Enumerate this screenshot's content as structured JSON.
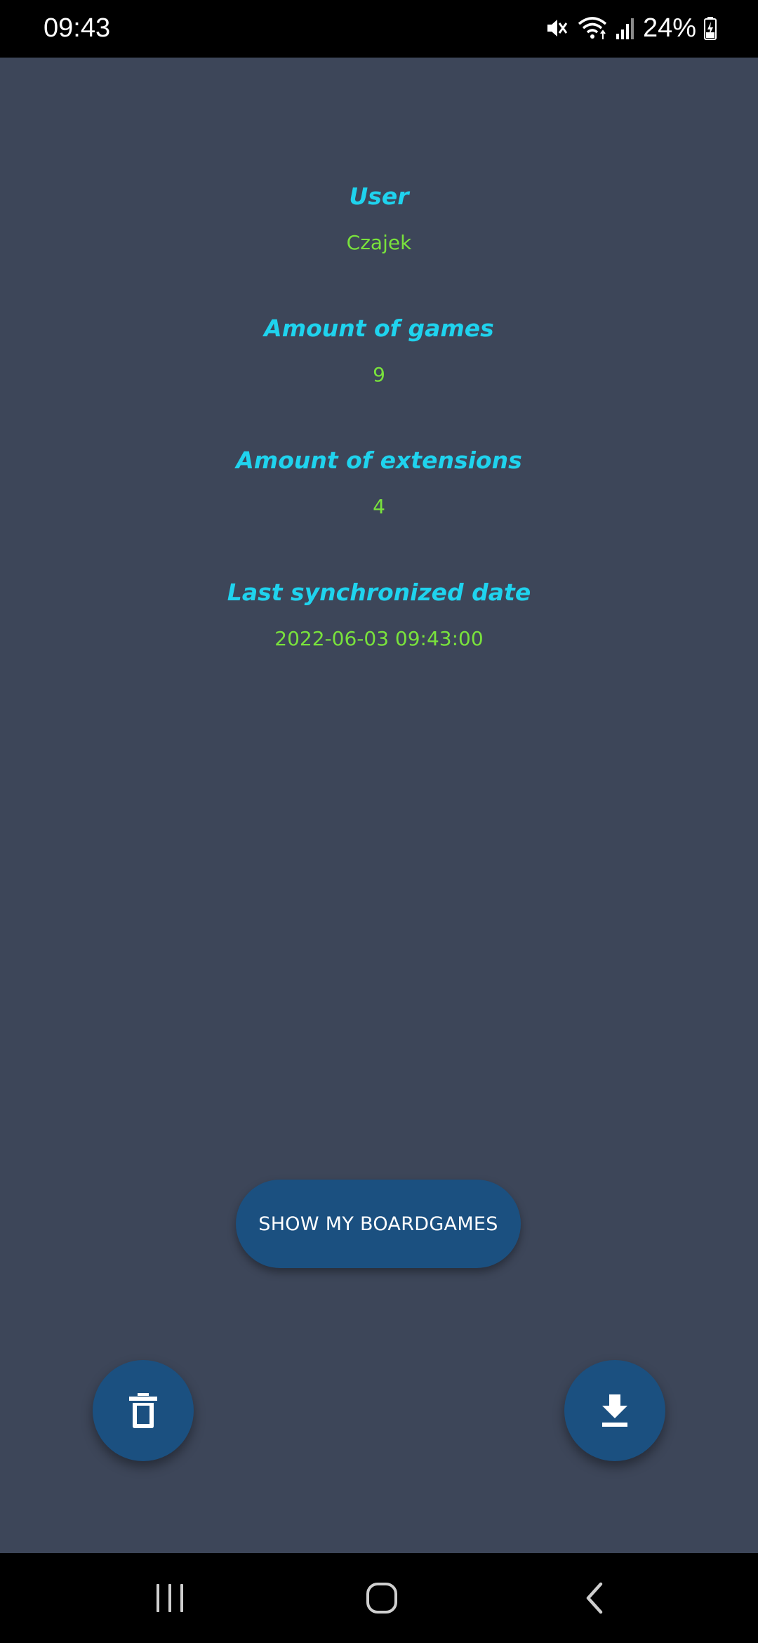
{
  "status_bar": {
    "time": "09:43",
    "battery_percent": "24%",
    "icons": [
      "mute-icon",
      "wifi-icon",
      "signal-icon",
      "battery-charging-icon"
    ]
  },
  "info": {
    "user_label": "User",
    "user_value": "Czajek",
    "games_label": "Amount of games",
    "games_value": "9",
    "extensions_label": "Amount of extensions",
    "extensions_value": "4",
    "sync_label": "Last synchronized date",
    "sync_value": "2022-06-03 09:43:00"
  },
  "actions": {
    "show_boardgames_label": "SHOW MY BOARDGAMES",
    "delete_icon": "trash-icon",
    "download_icon": "download-icon"
  },
  "nav_bar": {
    "icons": [
      "recents-icon",
      "home-icon",
      "back-icon"
    ]
  },
  "colors": {
    "background": "#3d4659",
    "label": "#1fd3ee",
    "value": "#79e23c",
    "button": "#1b5080"
  }
}
